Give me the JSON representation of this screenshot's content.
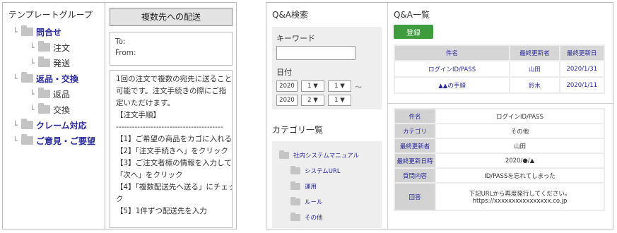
{
  "template": {
    "title": "テンプレートグループ",
    "tree": [
      {
        "branch": "└",
        "label": "問合せ",
        "level": 1
      },
      {
        "branch": "└",
        "label": "注文",
        "level": 2
      },
      {
        "branch": "└",
        "label": "発送",
        "level": 2
      },
      {
        "branch": "└",
        "label": "返品・交換",
        "level": 1
      },
      {
        "branch": "└",
        "label": "返品",
        "level": 2
      },
      {
        "branch": "└",
        "label": "交換",
        "level": 2
      },
      {
        "branch": "└",
        "label": "クレーム対応",
        "level": 1
      },
      {
        "branch": "└",
        "label": "ご意見・ご要望",
        "level": 1
      }
    ]
  },
  "compose": {
    "button_label": "複数先への配送",
    "to_label": "To:",
    "from_label": "From:",
    "body_lines": [
      "1回の注文で複数の宛先に送ることは",
      "可能です。注文手続きの際にご指",
      "定いただけます。",
      "【注文手順】",
      "----------------------------------------",
      "【1】ご希望の商品をカゴに入れる",
      "【2】「注文手続きへ」をクリック",
      "【3】ご注文者様の情報を入力して",
      "「次へ」をクリック",
      "【4】「複数配送先へ送る」にチェッ",
      "ク",
      "【5】1件ずつ配送先を入力"
    ]
  },
  "search": {
    "title": "Q&A検索",
    "keyword_label": "キーワード",
    "keyword_value": "",
    "date_label": "日付",
    "date_from": {
      "year": "2020",
      "month": "1 ▼",
      "day": "1 ▼"
    },
    "tilde": "～",
    "date_to": {
      "year": "2020",
      "month": "2 ▼",
      "day": "1 ▼"
    }
  },
  "category": {
    "title": "カテゴリ一覧",
    "root": "社内システムマニュアル",
    "items": [
      "システムURL",
      "運用",
      "ルール",
      "その他"
    ]
  },
  "qa": {
    "title": "Q&A一覧",
    "register_label": "登録",
    "list_headers": [
      "件名",
      "最終更新者",
      "最終更新日"
    ],
    "list_rows": [
      [
        "ログインID/PASS",
        "山田",
        "2020/1/31"
      ],
      [
        "▲▲の手順",
        "鈴木",
        "2020/1/11"
      ]
    ],
    "detail": {
      "subject_label": "件名",
      "subject": "ログインID/PASS",
      "category_label": "カテゴリ",
      "category": "その他",
      "updater_label": "最終更新者",
      "updater": "山田",
      "updated_label": "最終更新日時",
      "updated": "2020/●/▲",
      "question_label": "質問内容",
      "question": "ID/PASSを忘れてしまった",
      "answer_label": "回答",
      "answer_line1": "下記URLから再度発行してください。",
      "answer_line2": "https://xxxxxxxxxxxxxxxx.co.jp"
    }
  }
}
